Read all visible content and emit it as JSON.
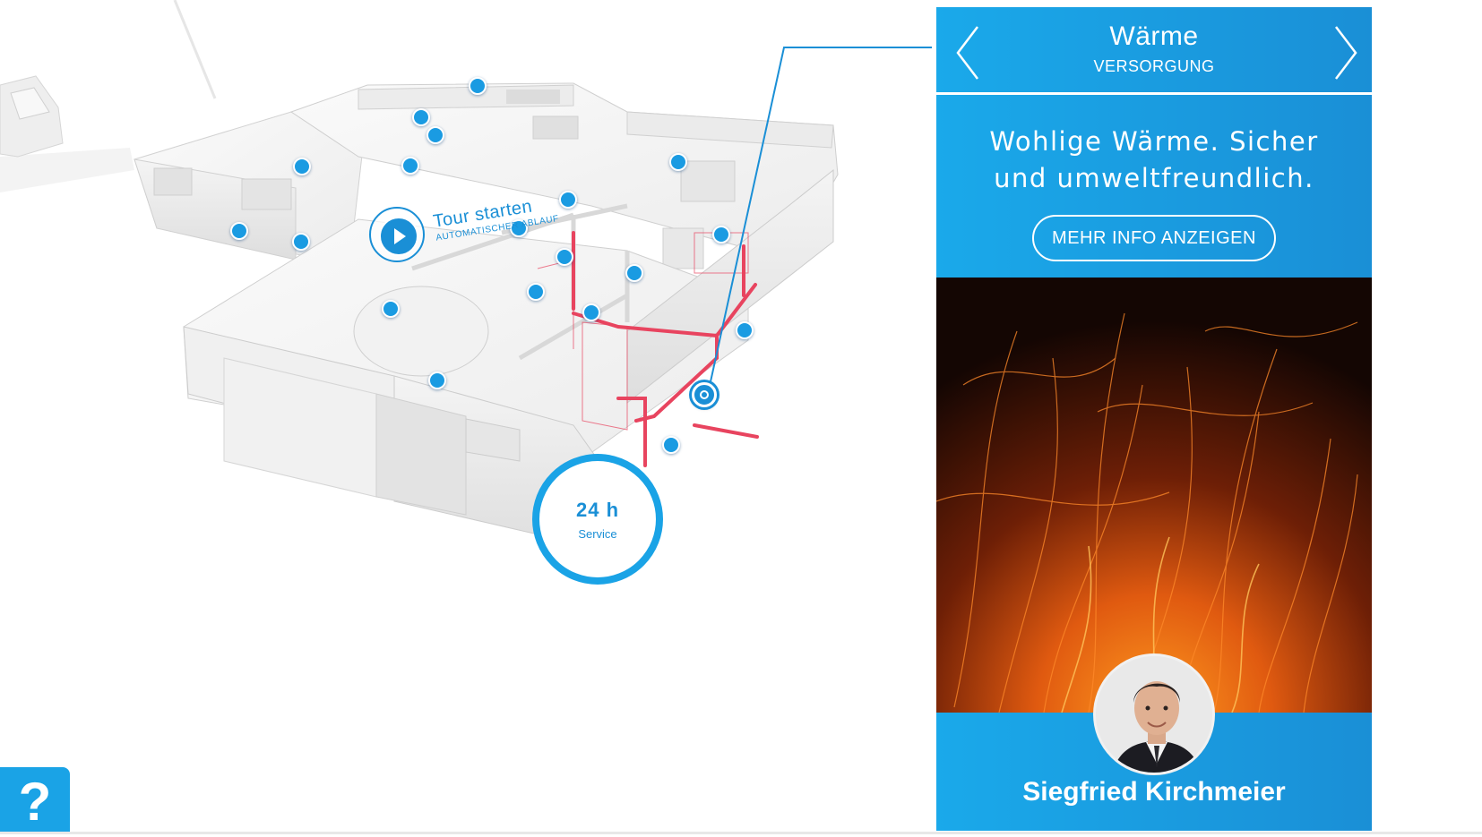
{
  "tour": {
    "title": "Tour starten",
    "subtitle": "AUTOMATISCHER ABLAUF"
  },
  "service": {
    "hours": "24 h",
    "label": "Service"
  },
  "help": {
    "label": "?"
  },
  "panel": {
    "title": "Wärme",
    "subtitle": "VERSORGUNG",
    "tagline_line1": "Wohlige Wärme. Sicher",
    "tagline_line2": "und umweltfreundlich.",
    "more_button": "MEHR INFO ANZEIGEN",
    "contact_name": "Siegfried Kirchmeier"
  },
  "colors": {
    "accent": "#1aa3e6",
    "accent_dark": "#1a8fd6",
    "pipe": "#e8445f",
    "hotspot": "#1a9be2"
  },
  "icons": [
    "play-icon",
    "chevron-left-icon",
    "chevron-right-icon",
    "question-icon",
    "hotspot-icon",
    "avatar-photo"
  ]
}
